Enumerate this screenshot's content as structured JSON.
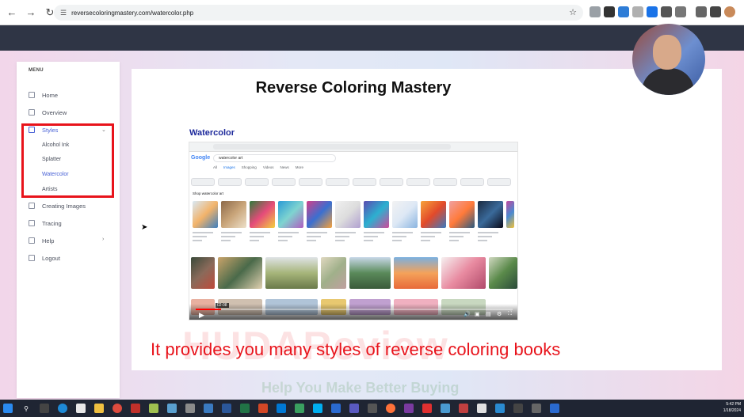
{
  "browser": {
    "url": "reversecoloringmastery.com/watercolor.php"
  },
  "sidebar": {
    "menu_title": "MENU",
    "items": [
      {
        "label": "Home"
      },
      {
        "label": "Overview"
      },
      {
        "label": "Styles"
      },
      {
        "label": "Creating Images"
      },
      {
        "label": "Tracing"
      },
      {
        "label": "Help"
      },
      {
        "label": "Logout"
      }
    ],
    "styles_subitems": [
      {
        "label": "Alcohol Ink"
      },
      {
        "label": "Splatter"
      },
      {
        "label": "Watercolor"
      },
      {
        "label": "Artists"
      }
    ]
  },
  "main": {
    "page_title": "Reverse Coloring Mastery",
    "section_heading": "Watercolor"
  },
  "video": {
    "google_logo": "Google",
    "search_query": "watercolor art",
    "tabs": [
      "All",
      "Images",
      "Shopping",
      "Videos",
      "News",
      "More"
    ],
    "sponsored_label": "Shop watercolor art",
    "timestamp": "02:08",
    "progress_fraction": 0.08
  },
  "caption": "It provides you many styles of reverse coloring books",
  "watermark": "HUDAReview",
  "watermark_tagline": "Help You Make Better Buying",
  "taskbar": {
    "time": "5:42 PM",
    "date": "1/18/2024"
  },
  "colors": {
    "accent": "#4a63d6",
    "highlight": "#e8131b",
    "header": "#2f3545",
    "heading": "#1e2a9c"
  }
}
